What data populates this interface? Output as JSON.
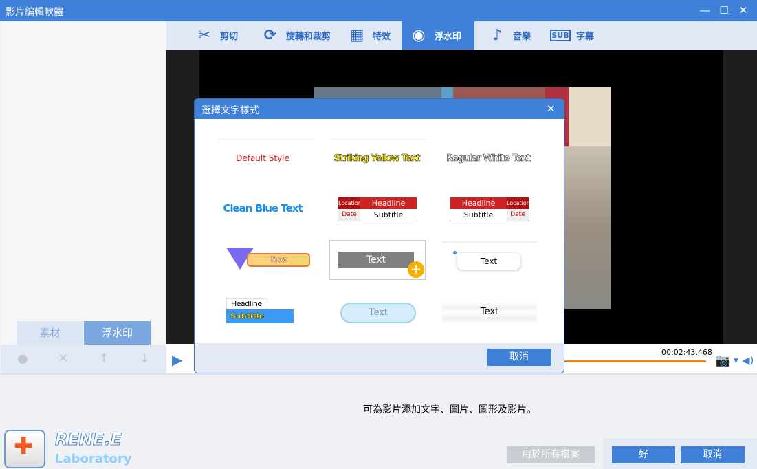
{
  "window": {
    "title": "影片編輯軟體",
    "minimize": "—",
    "maximize": "☐",
    "close": "✕"
  },
  "toolbar": {
    "items": [
      {
        "label": "剪切",
        "icon": "scissors-icon",
        "glyph": "✂"
      },
      {
        "label": "旋轉和裁剪",
        "icon": "rotate-crop-icon",
        "glyph": "⟳"
      },
      {
        "label": "特效",
        "icon": "effects-icon",
        "glyph": "🎞"
      },
      {
        "label": "浮水印",
        "icon": "watermark-icon",
        "glyph": "◉",
        "active": true
      },
      {
        "label": "音樂",
        "icon": "music-note-icon",
        "glyph": "♪"
      },
      {
        "label": "字幕",
        "icon": "subtitle-icon",
        "glyph": "SUB"
      }
    ]
  },
  "left_panel": {
    "tabs": [
      {
        "label": "素材"
      },
      {
        "label": "浮水印",
        "active": true
      }
    ],
    "tools": [
      {
        "icon": "lock-icon",
        "glyph": "🔒"
      },
      {
        "icon": "delete-icon",
        "glyph": "✕"
      },
      {
        "icon": "move-up-icon",
        "glyph": "↑"
      },
      {
        "icon": "move-down-icon",
        "glyph": "↓"
      }
    ]
  },
  "player": {
    "time": "00:02:43.468",
    "progress": 0.95
  },
  "bottom": {
    "hint": "可為影片添加文字、圖片、圖形及影片。",
    "apply_all": "用於所有檔案",
    "ok": "好",
    "cancel": "取消",
    "logo_name": "RENE.E",
    "logo_sub": "Laboratory"
  },
  "dialog": {
    "title": "選擇文字樣式",
    "close": "✕",
    "cancel": "取消",
    "styles": {
      "default": "Default Style",
      "yellow": "Striking Yellow Text",
      "white": "Regular White Text",
      "blue": "Clean Blue Text",
      "news1": {
        "location": "Location",
        "headline": "Headline",
        "date": "Date",
        "subtitle": "Subtitle"
      },
      "news2": {
        "headline": "Headline",
        "location": "Location",
        "subtitle": "Subtitle",
        "date": "Date"
      },
      "banner": "Text",
      "gray": "Text",
      "bubble": "Text",
      "lower": {
        "headline": "Headline",
        "subtitle": "Subtitle"
      },
      "bone": "Text",
      "brush": "Text"
    }
  }
}
